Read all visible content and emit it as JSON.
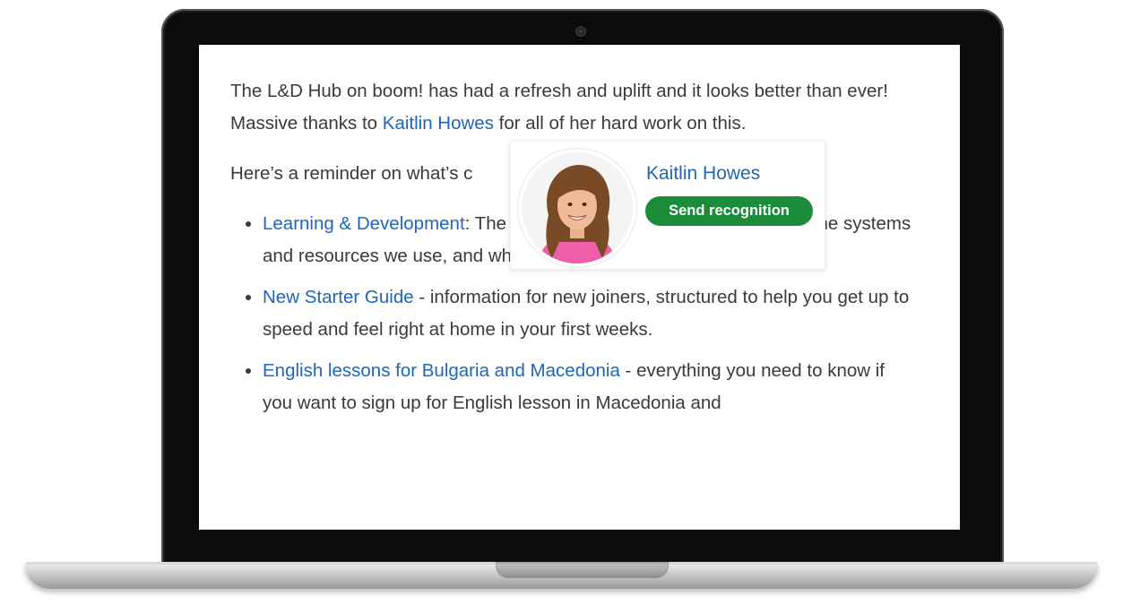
{
  "post": {
    "para1": {
      "text_before": "The L&D Hub on boom! has had a refresh and uplift and it looks better than ever! Massive thanks to ",
      "mention": "Kaitlin Howes",
      "text_after": " for all of her hard work on this."
    },
    "para2": "Here’s a reminder on what’s c",
    "list": [
      {
        "link": "Learning & Development",
        "sep": ": ",
        "text": "The home of information related to L&D - the systems and resources we use, and who’s who on the L&D team."
      },
      {
        "link": "New Starter Guide",
        "sep": " - ",
        "text": "information for new joiners, structured to help you get up to speed and feel right at home in your first weeks."
      },
      {
        "link": "English lessons for Bulgaria and Macedonia",
        "sep": " - ",
        "text": "everything you need to know if you want to sign up for English lesson in Macedonia and"
      }
    ]
  },
  "hovercard": {
    "name": "Kaitlin Howes",
    "button_label": "Send recognition"
  },
  "colors": {
    "link": "#1f66b8",
    "button": "#1d8c3a",
    "text": "#3a3a3a"
  }
}
